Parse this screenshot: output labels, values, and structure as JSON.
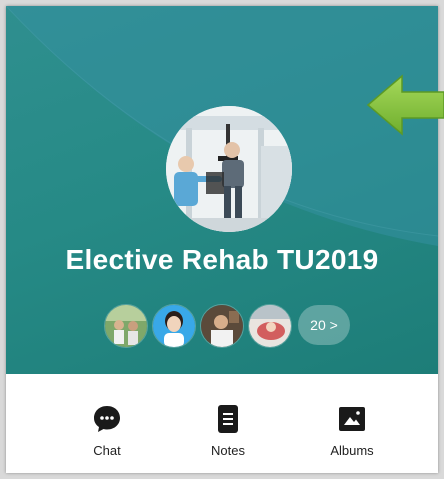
{
  "group": {
    "title": "Elective Rehab TU2019"
  },
  "members": {
    "more_label": "20 >",
    "avatar_icons": [
      "member-avatar-1",
      "member-avatar-2",
      "member-avatar-3",
      "member-avatar-4"
    ]
  },
  "actions": [
    {
      "label": "Chat",
      "icon": "chat-bubble-icon"
    },
    {
      "label": "Notes",
      "icon": "notes-icon"
    },
    {
      "label": "Albums",
      "icon": "albums-icon"
    }
  ],
  "colors": {
    "hero": "#268a86",
    "arrow": "#8cc63f"
  }
}
